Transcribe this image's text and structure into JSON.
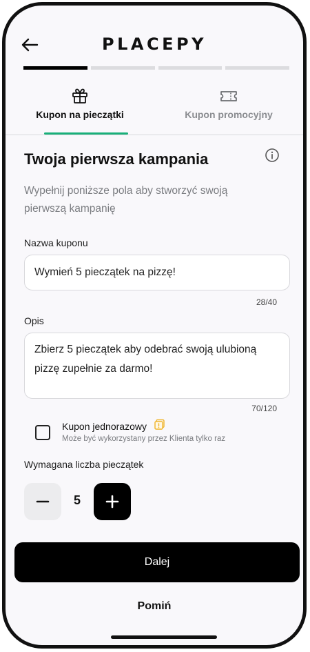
{
  "header": {
    "logo": "PLACEPY"
  },
  "steps": {
    "total": 4,
    "current": 1
  },
  "tabs": [
    {
      "label": "Kupon na pieczątki",
      "icon": "gift-icon",
      "active": true
    },
    {
      "label": "Kupon promocyjny",
      "icon": "ticket-icon",
      "active": false
    }
  ],
  "main": {
    "title": "Twoja pierwsza kampania",
    "subtitle": "Wypełnij poniższe pola aby stworzyć swoją pierwszą kampanię"
  },
  "form": {
    "name": {
      "label": "Nazwa kuponu",
      "value": "Wymień 5 pieczątek na pizzę!",
      "counter": "28/40"
    },
    "description": {
      "label": "Opis",
      "value": "Zbierz 5 pieczątek aby odebrać swoją ulubioną pizzę zupełnie za darmo!",
      "counter": "70/120"
    },
    "one_time": {
      "label": "Kupon jednorazowy",
      "hint": "Może być wykorzystany przez Klienta tylko raz",
      "checked": false
    },
    "stamps": {
      "label": "Wymagana liczba pieczątek",
      "value": "5"
    }
  },
  "actions": {
    "primary": "Dalej",
    "secondary": "Pomiń"
  },
  "colors": {
    "accent": "#19b07a",
    "warning": "#f0b429"
  }
}
